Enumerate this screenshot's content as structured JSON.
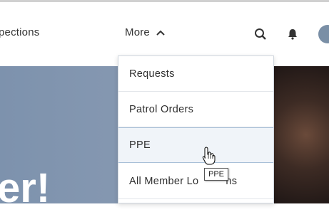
{
  "nav": {
    "partial_label": "pections",
    "more_label": "More",
    "icons": [
      "chevron-up-icon",
      "search-icon",
      "bell-icon",
      "avatar"
    ]
  },
  "hero": {
    "text": "er!"
  },
  "dropdown": {
    "items": [
      {
        "label": "Requests"
      },
      {
        "label": "Patrol Orders"
      },
      {
        "label": "PPE"
      },
      {
        "label": "All Member Lo"
      }
    ],
    "item4_suffix": "ns",
    "hovered": "PPE"
  },
  "tooltip": {
    "text": "PPE"
  },
  "colors": {
    "accent_border": "#a8c0d8",
    "hero_blue": "#7d92ad"
  }
}
